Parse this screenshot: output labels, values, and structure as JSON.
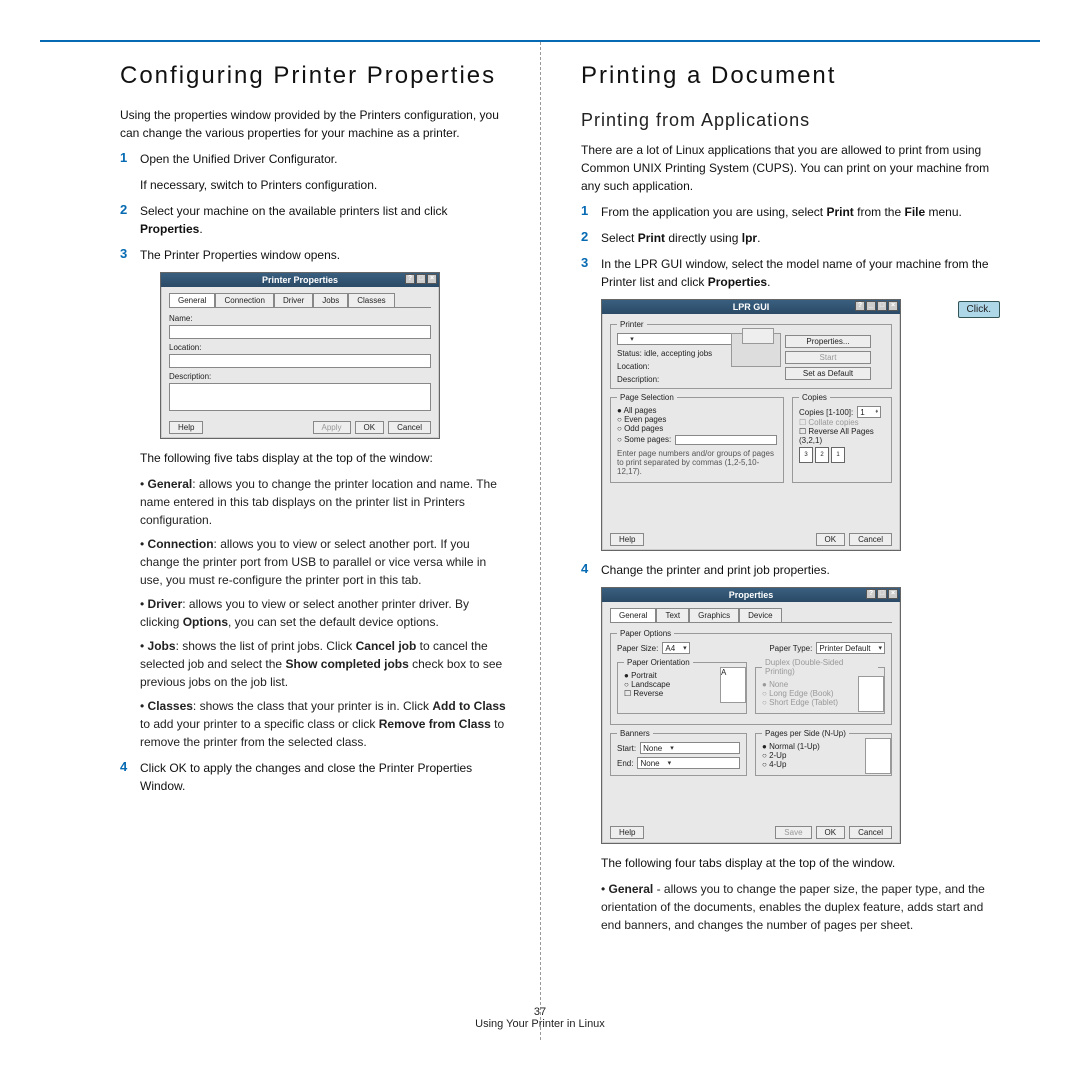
{
  "left": {
    "h2": "Configuring Printer Properties",
    "intro": "Using the properties window provided by the Printers configuration, you can change the various properties for your machine as a printer.",
    "steps": {
      "s1a": "Open the Unified Driver Configurator.",
      "s1b": "If necessary, switch to Printers configuration.",
      "s2a": "Select your machine on the available printers list and click ",
      "s2b": "Properties",
      "s3": "The Printer Properties window opens.",
      "afterDialog": "The following five tabs display at the top of the window:",
      "bullets": {
        "b1a": "General",
        "b1b": ": allows you to change the printer location and name. The name entered in this tab displays on the printer list in Printers configuration.",
        "b2a": "Connection",
        "b2b": ": allows you to view or select another port. If you change the printer port from USB to parallel or vice versa while in use, you must re-configure the printer port in this tab.",
        "b3a": "Driver",
        "b3b": ": allows you to view or select another printer driver. By clicking ",
        "b3c": "Options",
        "b3d": ", you can set the default device options.",
        "b4a": "Jobs",
        "b4b": ": shows the list of print jobs. Click ",
        "b4c": "Cancel job",
        "b4d": " to cancel the selected job and select the ",
        "b4e": "Show completed jobs",
        "b4f": " check box to see previous jobs on the job list.",
        "b5a": "Classes",
        "b5b": ": shows the class that your printer is in. Click ",
        "b5c": "Add to Class",
        "b5d": " to add your printer to a specific class or click ",
        "b5e": "Remove from Class",
        "b5f": " to remove the printer from the selected class."
      },
      "s4": "Click OK to apply the changes and close the Printer Properties Window."
    },
    "dialog1": {
      "title": "Printer Properties",
      "tabs": [
        "General",
        "Connection",
        "Driver",
        "Jobs",
        "Classes"
      ],
      "name": "Name:",
      "location": "Location:",
      "description": "Description:",
      "help": "Help",
      "apply": "Apply",
      "ok": "OK",
      "cancel": "Cancel"
    }
  },
  "right": {
    "h2": "Printing a Document",
    "h3": "Printing from Applications",
    "intro": "There are a lot of Linux applications that you are allowed to print from using Common UNIX Printing System (CUPS). You can print on your machine from any such application.",
    "s1a": "From the application you are using, select ",
    "s1b": "Print",
    "s1c": " from the ",
    "s1d": "File",
    "s1e": " menu.",
    "s2a": "Select ",
    "s2b": "Print",
    "s2c": " directly using ",
    "s2d": "lpr",
    "s2e": ".",
    "s3a": "In the LPR GUI window, select the model name of your machine from the Printer list and click ",
    "s3b": "Properties",
    "s3c": ".",
    "callout": "Click.",
    "s4": "Change the printer and print job properties.",
    "tabsLine": "The following four tabs display at the top of the window.",
    "bullet": {
      "a": "General",
      "b": " - allows you to change the paper size, the paper type, and the orientation of the documents, enables the duplex feature, adds start and end banners, and changes the number of pages per sheet."
    },
    "lpr": {
      "title": "LPR GUI",
      "printer": "Printer",
      "status": "Status: idle, accepting jobs",
      "location": "Location:",
      "description": "Description:",
      "properties": "Properties...",
      "start": "Start",
      "setdef": "Set as Default",
      "pageSel": "Page Selection",
      "all": "All pages",
      "even": "Even pages",
      "odd": "Odd pages",
      "some": "Some pages:",
      "hint": "Enter page numbers and/or groups of pages to print separated by commas (1,2-5,10-12,17).",
      "copies": "Copies",
      "copiesLbl": "Copies [1-100]:",
      "copiesVal": "1",
      "collate": "Collate copies",
      "reverse": "Reverse All Pages (3,2,1)",
      "help": "Help",
      "ok": "OK",
      "cancel": "Cancel"
    },
    "props": {
      "title": "Properties",
      "tabs": [
        "General",
        "Text",
        "Graphics",
        "Device"
      ],
      "paperOptions": "Paper Options",
      "paperSize": "Paper Size:",
      "paperSizeVal": "A4",
      "paperType": "Paper Type:",
      "paperTypeVal": "Printer Default",
      "orientation": "Paper Orientation",
      "portrait": "Portrait",
      "landscape": "Landscape",
      "reverse": "Reverse",
      "duplex": "Duplex (Double-Sided Printing)",
      "dNone": "None",
      "dLong": "Long Edge (Book)",
      "dShort": "Short Edge (Tablet)",
      "banners": "Banners",
      "start": "Start:",
      "end": "End:",
      "none": "None",
      "pps": "Pages per Side (N-Up)",
      "normal": "Normal (1-Up)",
      "two": "2-Up",
      "four": "4-Up",
      "help": "Help",
      "save": "Save",
      "ok": "OK",
      "cancel": "Cancel"
    }
  },
  "footer": {
    "page": "37",
    "section": "Using Your Printer in Linux"
  }
}
